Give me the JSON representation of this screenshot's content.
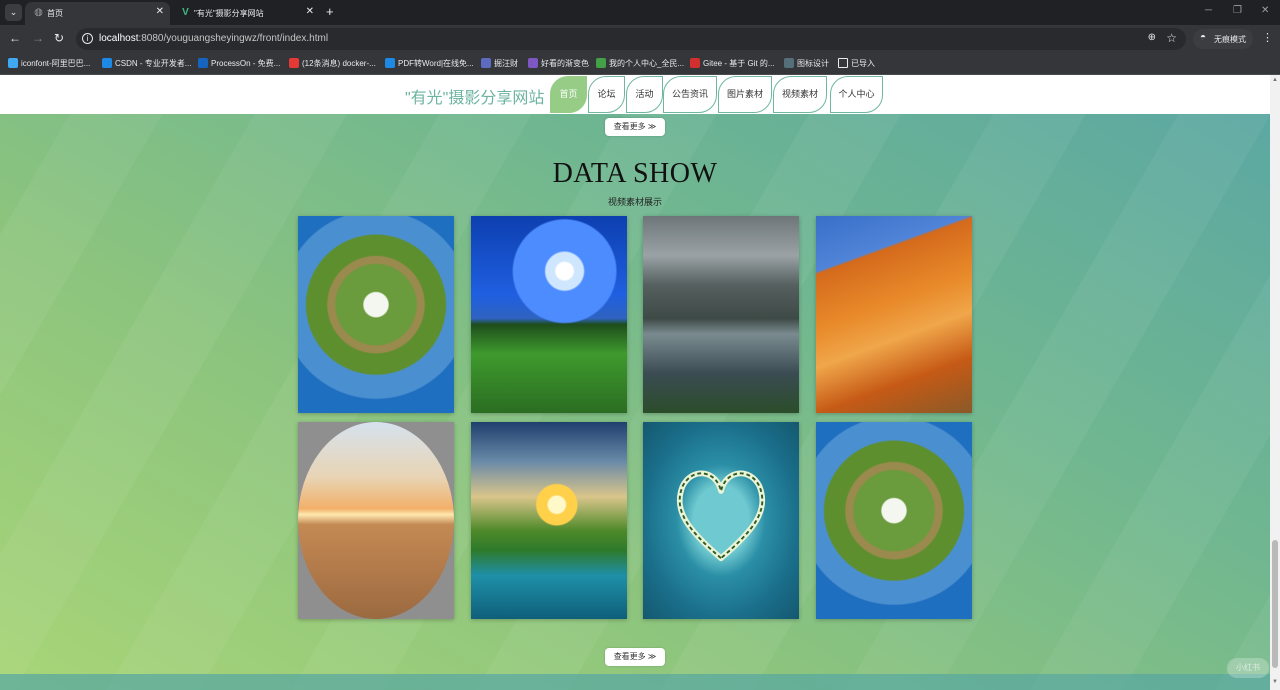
{
  "browser": {
    "tabs": [
      {
        "title": "首页",
        "active": true
      },
      {
        "title": "\"有光\"摄影分享网站",
        "active": false
      }
    ],
    "new_tab": "+",
    "url_host": "localhost",
    "url_rest": ":8080/youguangsheyingwz/front/index.html",
    "incognito_label": "无痕模式",
    "bookmarks": [
      {
        "label": "iconfont-阿里巴巴...",
        "color": "#3fa9f5"
      },
      {
        "label": "CSDN - 专业开发者...",
        "color": "#1e88e5"
      },
      {
        "label": "ProcessOn - 免费...",
        "color": "#1565c0"
      },
      {
        "label": "(12条消息) docker-...",
        "color": "#e53935"
      },
      {
        "label": "PDF转Word|在线免...",
        "color": "#1e88e5"
      },
      {
        "label": "掘汪财",
        "color": "#5c6bc0"
      },
      {
        "label": "好看的渐变色",
        "color": "#7e57c2"
      },
      {
        "label": "我的个人中心_全民...",
        "color": "#43a047"
      },
      {
        "label": "Gitee - 基于 Git 的...",
        "color": "#d32f2f"
      },
      {
        "label": "图标设计",
        "color": "#546e7a"
      },
      {
        "label": "已导入",
        "color": "transparent"
      }
    ]
  },
  "site": {
    "title": "\"有光\"摄影分享网站",
    "nav": [
      {
        "label": "首页",
        "active": true
      },
      {
        "label": "论坛",
        "active": false
      },
      {
        "label": "活动",
        "active": false
      },
      {
        "label": "公告资讯",
        "active": false
      },
      {
        "label": "图片素材",
        "active": false
      },
      {
        "label": "视频素材",
        "active": false
      },
      {
        "label": "个人中心",
        "active": false
      }
    ],
    "more_label": "查看更多 ≫",
    "section_title": "DATA SHOW",
    "section_subtitle": "视频素材展示",
    "gallery": [
      {
        "kind": "planet"
      },
      {
        "kind": "moon"
      },
      {
        "kind": "lake"
      },
      {
        "kind": "mountain"
      },
      {
        "kind": "desert"
      },
      {
        "kind": "valley"
      },
      {
        "kind": "heart"
      },
      {
        "kind": "planet"
      }
    ],
    "watermark": "小红书"
  },
  "colors": {
    "accent": "#96cc86",
    "title": "#6db4a0",
    "nav_border": "#6fb89f"
  }
}
